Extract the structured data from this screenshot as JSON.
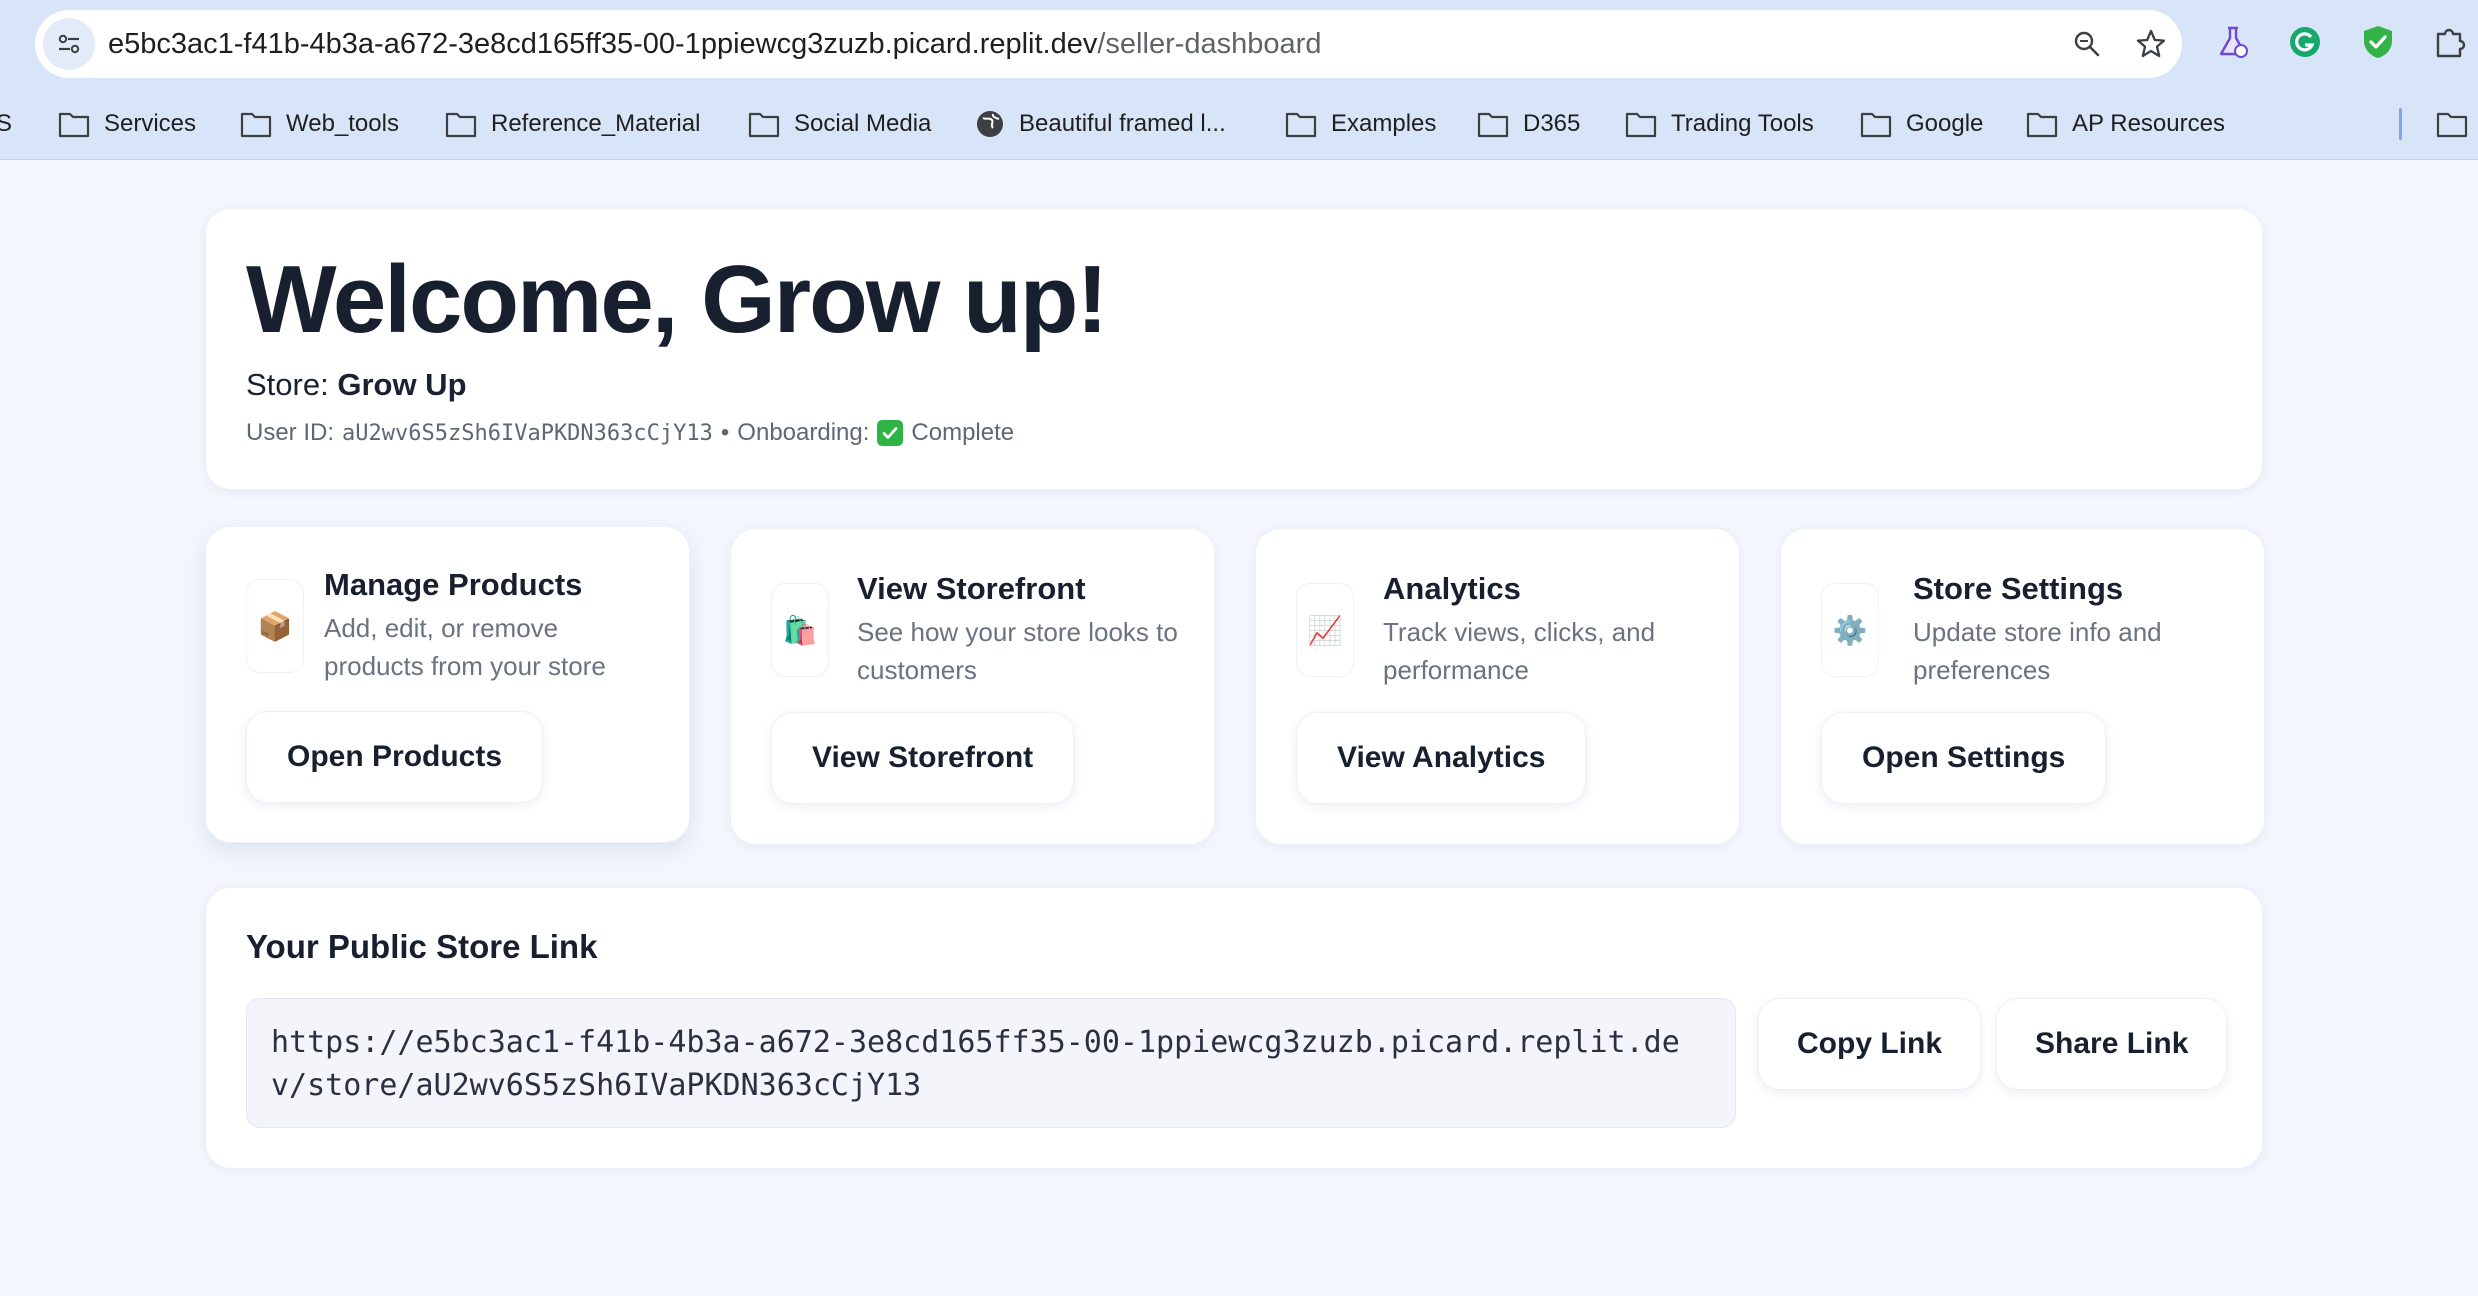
{
  "browser": {
    "url_host": "e5bc3ac1-f41b-4b3a-a672-3e8cd165ff35-00-1ppiewcg3zuzb.picard.replit.dev",
    "url_path": "/seller-dashboard",
    "bookmarks": [
      {
        "label": "PS",
        "icon": "folder-icon"
      },
      {
        "label": "Services",
        "icon": "folder-icon"
      },
      {
        "label": "Web_tools",
        "icon": "folder-icon"
      },
      {
        "label": "Reference_Material",
        "icon": "folder-icon"
      },
      {
        "label": "Social Media",
        "icon": "folder-icon"
      },
      {
        "label": "Beautiful framed l...",
        "icon": "globe-icon"
      },
      {
        "label": "Examples",
        "icon": "folder-icon"
      },
      {
        "label": "D365",
        "icon": "folder-icon"
      },
      {
        "label": "Trading Tools",
        "icon": "folder-icon"
      },
      {
        "label": "Google",
        "icon": "folder-icon"
      },
      {
        "label": "AP Resources",
        "icon": "folder-icon"
      }
    ]
  },
  "welcome": {
    "heading": "Welcome, Grow up!",
    "store_label": "Store:",
    "store_name": "Grow Up",
    "user_id_label": "User ID:",
    "user_id": "aU2wv6S5zSh6IVaPKDN363cCjY13",
    "separator": "•",
    "onboarding_label": "Onboarding:",
    "onboarding_status": "Complete"
  },
  "actions": [
    {
      "icon": "package-icon",
      "glyph": "📦",
      "title": "Manage Products",
      "desc": "Add, edit, or remove products from your store",
      "button": "Open Products"
    },
    {
      "icon": "shopping-bags-icon",
      "glyph": "🛍️",
      "title": "View Storefront",
      "desc": "See how your store looks to customers",
      "button": "View Storefront"
    },
    {
      "icon": "chart-increasing-icon",
      "glyph": "📈",
      "title": "Analytics",
      "desc": "Track views, clicks, and performance",
      "button": "View Analytics"
    },
    {
      "icon": "gear-icon",
      "glyph": "⚙️",
      "title": "Store Settings",
      "desc": "Update store info and preferences",
      "button": "Open Settings"
    }
  ],
  "public_link": {
    "heading": "Your Public Store Link",
    "url": "https://e5bc3ac1-f41b-4b3a-a672-3e8cd165ff35-00-1ppiewcg3zuzb.picard.replit.dev/store/aU2wv6S5zSh6IVaPKDN363cCjY13",
    "copy_label": "Copy Link",
    "share_label": "Share Link"
  }
}
